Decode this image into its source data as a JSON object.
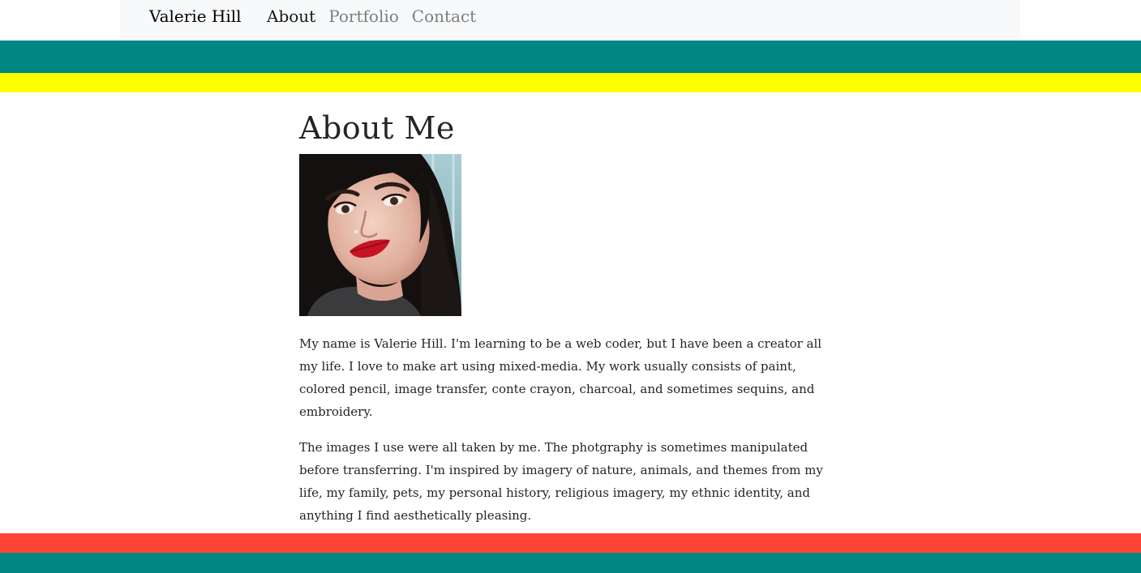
{
  "nav": {
    "brand": "Valerie Hill",
    "links": [
      {
        "label": "About"
      },
      {
        "label": "Portfolio"
      },
      {
        "label": "Contact"
      }
    ]
  },
  "main": {
    "title": "About Me",
    "paragraphs": [
      "My name is Valerie Hill. I'm learning to be a web coder, but I have been a creator all my life. I love to make art using mixed-media. My work usually consists of paint, colored pencil, image transfer, conte crayon, charcoal, and sometimes sequins, and embroidery.",
      "The images I use were all taken by me. The photgraphy is sometimes manipulated before transferring. I'm inspired by imagery of nature, animals, and themes from my life, my family, pets, my personal history, religious imagery, my ethnic identity, and anything I find aesthetically pleasing."
    ]
  },
  "colors": {
    "teal": "#008683",
    "yellow": "#ffff00",
    "red": "#ff4433",
    "navbar_bg": "#f8f9fa"
  }
}
